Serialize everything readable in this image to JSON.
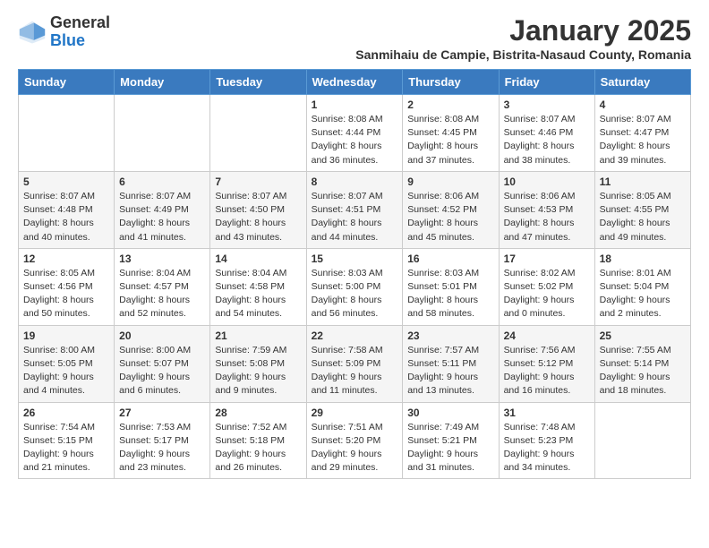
{
  "logo": {
    "general": "General",
    "blue": "Blue"
  },
  "header": {
    "month": "January 2025",
    "location": "Sanmihaiu de Campie, Bistrita-Nasaud County, Romania"
  },
  "weekdays": [
    "Sunday",
    "Monday",
    "Tuesday",
    "Wednesday",
    "Thursday",
    "Friday",
    "Saturday"
  ],
  "weeks": [
    [
      {
        "day": "",
        "info": ""
      },
      {
        "day": "",
        "info": ""
      },
      {
        "day": "",
        "info": ""
      },
      {
        "day": "1",
        "info": "Sunrise: 8:08 AM\nSunset: 4:44 PM\nDaylight: 8 hours and 36 minutes."
      },
      {
        "day": "2",
        "info": "Sunrise: 8:08 AM\nSunset: 4:45 PM\nDaylight: 8 hours and 37 minutes."
      },
      {
        "day": "3",
        "info": "Sunrise: 8:07 AM\nSunset: 4:46 PM\nDaylight: 8 hours and 38 minutes."
      },
      {
        "day": "4",
        "info": "Sunrise: 8:07 AM\nSunset: 4:47 PM\nDaylight: 8 hours and 39 minutes."
      }
    ],
    [
      {
        "day": "5",
        "info": "Sunrise: 8:07 AM\nSunset: 4:48 PM\nDaylight: 8 hours and 40 minutes."
      },
      {
        "day": "6",
        "info": "Sunrise: 8:07 AM\nSunset: 4:49 PM\nDaylight: 8 hours and 41 minutes."
      },
      {
        "day": "7",
        "info": "Sunrise: 8:07 AM\nSunset: 4:50 PM\nDaylight: 8 hours and 43 minutes."
      },
      {
        "day": "8",
        "info": "Sunrise: 8:07 AM\nSunset: 4:51 PM\nDaylight: 8 hours and 44 minutes."
      },
      {
        "day": "9",
        "info": "Sunrise: 8:06 AM\nSunset: 4:52 PM\nDaylight: 8 hours and 45 minutes."
      },
      {
        "day": "10",
        "info": "Sunrise: 8:06 AM\nSunset: 4:53 PM\nDaylight: 8 hours and 47 minutes."
      },
      {
        "day": "11",
        "info": "Sunrise: 8:05 AM\nSunset: 4:55 PM\nDaylight: 8 hours and 49 minutes."
      }
    ],
    [
      {
        "day": "12",
        "info": "Sunrise: 8:05 AM\nSunset: 4:56 PM\nDaylight: 8 hours and 50 minutes."
      },
      {
        "day": "13",
        "info": "Sunrise: 8:04 AM\nSunset: 4:57 PM\nDaylight: 8 hours and 52 minutes."
      },
      {
        "day": "14",
        "info": "Sunrise: 8:04 AM\nSunset: 4:58 PM\nDaylight: 8 hours and 54 minutes."
      },
      {
        "day": "15",
        "info": "Sunrise: 8:03 AM\nSunset: 5:00 PM\nDaylight: 8 hours and 56 minutes."
      },
      {
        "day": "16",
        "info": "Sunrise: 8:03 AM\nSunset: 5:01 PM\nDaylight: 8 hours and 58 minutes."
      },
      {
        "day": "17",
        "info": "Sunrise: 8:02 AM\nSunset: 5:02 PM\nDaylight: 9 hours and 0 minutes."
      },
      {
        "day": "18",
        "info": "Sunrise: 8:01 AM\nSunset: 5:04 PM\nDaylight: 9 hours and 2 minutes."
      }
    ],
    [
      {
        "day": "19",
        "info": "Sunrise: 8:00 AM\nSunset: 5:05 PM\nDaylight: 9 hours and 4 minutes."
      },
      {
        "day": "20",
        "info": "Sunrise: 8:00 AM\nSunset: 5:07 PM\nDaylight: 9 hours and 6 minutes."
      },
      {
        "day": "21",
        "info": "Sunrise: 7:59 AM\nSunset: 5:08 PM\nDaylight: 9 hours and 9 minutes."
      },
      {
        "day": "22",
        "info": "Sunrise: 7:58 AM\nSunset: 5:09 PM\nDaylight: 9 hours and 11 minutes."
      },
      {
        "day": "23",
        "info": "Sunrise: 7:57 AM\nSunset: 5:11 PM\nDaylight: 9 hours and 13 minutes."
      },
      {
        "day": "24",
        "info": "Sunrise: 7:56 AM\nSunset: 5:12 PM\nDaylight: 9 hours and 16 minutes."
      },
      {
        "day": "25",
        "info": "Sunrise: 7:55 AM\nSunset: 5:14 PM\nDaylight: 9 hours and 18 minutes."
      }
    ],
    [
      {
        "day": "26",
        "info": "Sunrise: 7:54 AM\nSunset: 5:15 PM\nDaylight: 9 hours and 21 minutes."
      },
      {
        "day": "27",
        "info": "Sunrise: 7:53 AM\nSunset: 5:17 PM\nDaylight: 9 hours and 23 minutes."
      },
      {
        "day": "28",
        "info": "Sunrise: 7:52 AM\nSunset: 5:18 PM\nDaylight: 9 hours and 26 minutes."
      },
      {
        "day": "29",
        "info": "Sunrise: 7:51 AM\nSunset: 5:20 PM\nDaylight: 9 hours and 29 minutes."
      },
      {
        "day": "30",
        "info": "Sunrise: 7:49 AM\nSunset: 5:21 PM\nDaylight: 9 hours and 31 minutes."
      },
      {
        "day": "31",
        "info": "Sunrise: 7:48 AM\nSunset: 5:23 PM\nDaylight: 9 hours and 34 minutes."
      },
      {
        "day": "",
        "info": ""
      }
    ]
  ]
}
